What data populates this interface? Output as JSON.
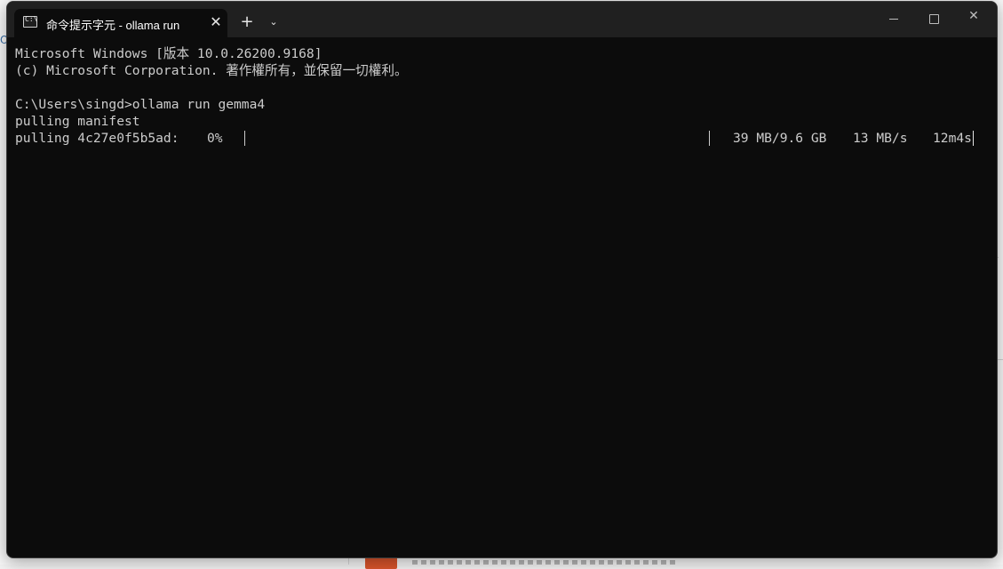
{
  "window": {
    "tab_title": "命令提示字元 - ollama  run",
    "tab_icon_glyph": "C:\\",
    "tab_close": "✕",
    "new_tab": "+",
    "tab_dropdown": "⌄",
    "close_glyph": "✕"
  },
  "console": {
    "lines": [
      "Microsoft Windows [版本 10.0.26200.9168]",
      "(c) Microsoft Corporation. 著作權所有，並保留一切權利。",
      "C:\\Users\\singd>ollama run gemma4",
      "pulling manifest"
    ],
    "pull": {
      "label": "pulling 4c27e0f5b5ad:",
      "percent_text": "0%",
      "progress": 0.0,
      "size": "39 MB/9.6 GB",
      "speed": "13 MB/s",
      "eta": "12m4s"
    }
  },
  "background": {
    "left_mark": "O",
    "right_mark": "/"
  }
}
